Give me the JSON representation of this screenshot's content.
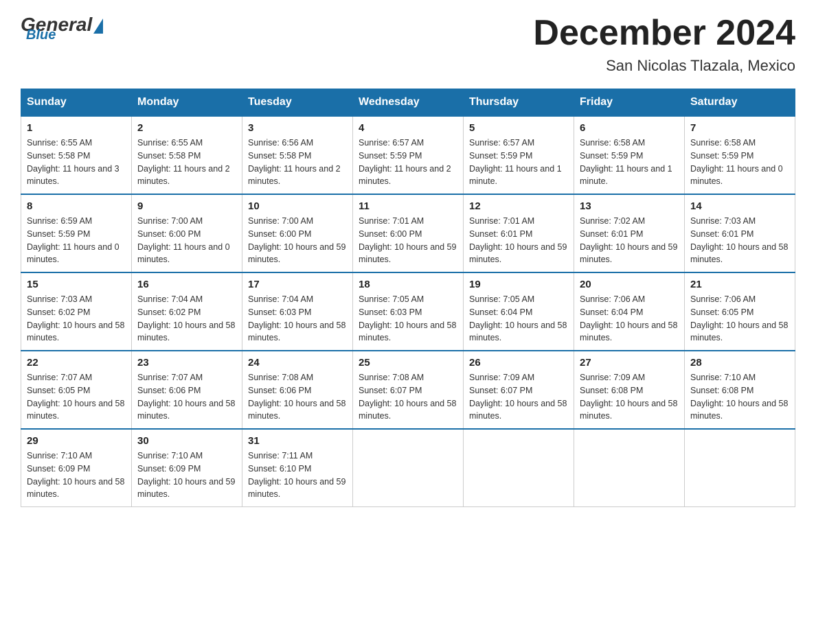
{
  "header": {
    "logo": {
      "general": "General",
      "blue": "Blue"
    },
    "title": "December 2024",
    "location": "San Nicolas Tlazala, Mexico"
  },
  "weekdays": [
    "Sunday",
    "Monday",
    "Tuesday",
    "Wednesday",
    "Thursday",
    "Friday",
    "Saturday"
  ],
  "weeks": [
    [
      {
        "day": "1",
        "sunrise": "6:55 AM",
        "sunset": "5:58 PM",
        "daylight": "11 hours and 3 minutes."
      },
      {
        "day": "2",
        "sunrise": "6:55 AM",
        "sunset": "5:58 PM",
        "daylight": "11 hours and 2 minutes."
      },
      {
        "day": "3",
        "sunrise": "6:56 AM",
        "sunset": "5:58 PM",
        "daylight": "11 hours and 2 minutes."
      },
      {
        "day": "4",
        "sunrise": "6:57 AM",
        "sunset": "5:59 PM",
        "daylight": "11 hours and 2 minutes."
      },
      {
        "day": "5",
        "sunrise": "6:57 AM",
        "sunset": "5:59 PM",
        "daylight": "11 hours and 1 minute."
      },
      {
        "day": "6",
        "sunrise": "6:58 AM",
        "sunset": "5:59 PM",
        "daylight": "11 hours and 1 minute."
      },
      {
        "day": "7",
        "sunrise": "6:58 AM",
        "sunset": "5:59 PM",
        "daylight": "11 hours and 0 minutes."
      }
    ],
    [
      {
        "day": "8",
        "sunrise": "6:59 AM",
        "sunset": "5:59 PM",
        "daylight": "11 hours and 0 minutes."
      },
      {
        "day": "9",
        "sunrise": "7:00 AM",
        "sunset": "6:00 PM",
        "daylight": "11 hours and 0 minutes."
      },
      {
        "day": "10",
        "sunrise": "7:00 AM",
        "sunset": "6:00 PM",
        "daylight": "10 hours and 59 minutes."
      },
      {
        "day": "11",
        "sunrise": "7:01 AM",
        "sunset": "6:00 PM",
        "daylight": "10 hours and 59 minutes."
      },
      {
        "day": "12",
        "sunrise": "7:01 AM",
        "sunset": "6:01 PM",
        "daylight": "10 hours and 59 minutes."
      },
      {
        "day": "13",
        "sunrise": "7:02 AM",
        "sunset": "6:01 PM",
        "daylight": "10 hours and 59 minutes."
      },
      {
        "day": "14",
        "sunrise": "7:03 AM",
        "sunset": "6:01 PM",
        "daylight": "10 hours and 58 minutes."
      }
    ],
    [
      {
        "day": "15",
        "sunrise": "7:03 AM",
        "sunset": "6:02 PM",
        "daylight": "10 hours and 58 minutes."
      },
      {
        "day": "16",
        "sunrise": "7:04 AM",
        "sunset": "6:02 PM",
        "daylight": "10 hours and 58 minutes."
      },
      {
        "day": "17",
        "sunrise": "7:04 AM",
        "sunset": "6:03 PM",
        "daylight": "10 hours and 58 minutes."
      },
      {
        "day": "18",
        "sunrise": "7:05 AM",
        "sunset": "6:03 PM",
        "daylight": "10 hours and 58 minutes."
      },
      {
        "day": "19",
        "sunrise": "7:05 AM",
        "sunset": "6:04 PM",
        "daylight": "10 hours and 58 minutes."
      },
      {
        "day": "20",
        "sunrise": "7:06 AM",
        "sunset": "6:04 PM",
        "daylight": "10 hours and 58 minutes."
      },
      {
        "day": "21",
        "sunrise": "7:06 AM",
        "sunset": "6:05 PM",
        "daylight": "10 hours and 58 minutes."
      }
    ],
    [
      {
        "day": "22",
        "sunrise": "7:07 AM",
        "sunset": "6:05 PM",
        "daylight": "10 hours and 58 minutes."
      },
      {
        "day": "23",
        "sunrise": "7:07 AM",
        "sunset": "6:06 PM",
        "daylight": "10 hours and 58 minutes."
      },
      {
        "day": "24",
        "sunrise": "7:08 AM",
        "sunset": "6:06 PM",
        "daylight": "10 hours and 58 minutes."
      },
      {
        "day": "25",
        "sunrise": "7:08 AM",
        "sunset": "6:07 PM",
        "daylight": "10 hours and 58 minutes."
      },
      {
        "day": "26",
        "sunrise": "7:09 AM",
        "sunset": "6:07 PM",
        "daylight": "10 hours and 58 minutes."
      },
      {
        "day": "27",
        "sunrise": "7:09 AM",
        "sunset": "6:08 PM",
        "daylight": "10 hours and 58 minutes."
      },
      {
        "day": "28",
        "sunrise": "7:10 AM",
        "sunset": "6:08 PM",
        "daylight": "10 hours and 58 minutes."
      }
    ],
    [
      {
        "day": "29",
        "sunrise": "7:10 AM",
        "sunset": "6:09 PM",
        "daylight": "10 hours and 58 minutes."
      },
      {
        "day": "30",
        "sunrise": "7:10 AM",
        "sunset": "6:09 PM",
        "daylight": "10 hours and 59 minutes."
      },
      {
        "day": "31",
        "sunrise": "7:11 AM",
        "sunset": "6:10 PM",
        "daylight": "10 hours and 59 minutes."
      },
      null,
      null,
      null,
      null
    ]
  ]
}
